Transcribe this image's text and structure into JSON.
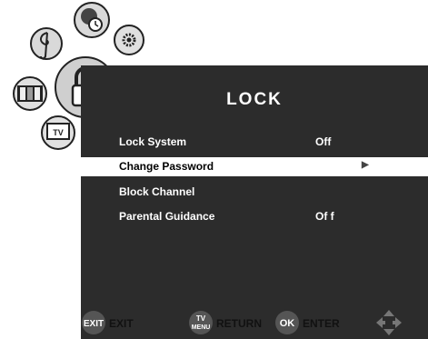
{
  "menu": {
    "title": "LOCK",
    "items": [
      {
        "label": "Lock  System",
        "value": "Off"
      },
      {
        "label": "Change  Password",
        "value": ""
      },
      {
        "label": "Block Channel",
        "value": ""
      },
      {
        "label": "Parental  Guidance",
        "value": "Of f"
      }
    ],
    "selected_index": 1
  },
  "icons": [
    {
      "name": "music-icon",
      "selected": false
    },
    {
      "name": "clock-icon",
      "selected": false
    },
    {
      "name": "settings-icon",
      "selected": false
    },
    {
      "name": "picture-icon",
      "selected": false
    },
    {
      "name": "lock-icon",
      "selected": true
    },
    {
      "name": "tv-icon",
      "selected": false,
      "label": "TV"
    }
  ],
  "footer": {
    "exit_button": "EXIT",
    "exit_label": "EXIT",
    "menu_button_top": "TV",
    "menu_button_bottom": "MENU",
    "return_label": "RETURN",
    "ok_button": "OK",
    "enter_label": "ENTER",
    "nav_icon": "dpad-arrows-icon"
  }
}
